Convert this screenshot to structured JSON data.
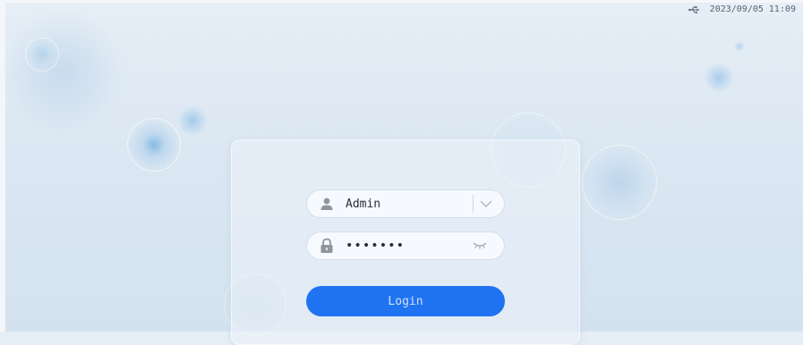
{
  "status": {
    "icon": "usb-icon",
    "datetime": "2023/09/05 11:09"
  },
  "login": {
    "username": {
      "icon": "user-icon",
      "value": "Admin",
      "dropdown_icon": "chevron-down-icon"
    },
    "password": {
      "icon": "lock-icon",
      "value": "1234567",
      "visibility_icon": "eye-closed-icon"
    },
    "button_label": "Login"
  },
  "colors": {
    "accent": "#1f73f0",
    "background": "#dbe7f2"
  }
}
